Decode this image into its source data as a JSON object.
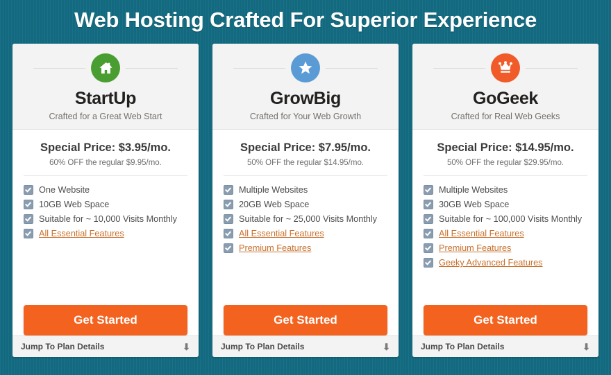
{
  "header": {
    "title": "Web Hosting Crafted For Superior Experience"
  },
  "colors": {
    "page_background": "#136c82",
    "cta_orange": "#f4621f",
    "link_orange": "#c8712d",
    "startup_icon": "#4a9e31",
    "growbig_icon": "#5b9bd5",
    "gogeek_icon": "#f15a29",
    "checkbox": "#8a9cb0"
  },
  "footer_label": "Jump To Plan Details",
  "cta_label": "Get Started",
  "plans": [
    {
      "name": "StartUp",
      "tagline": "Crafted for a Great Web Start",
      "icon": "house-icon",
      "icon_color": "#4a9e31",
      "price": "Special Price: $3.95/mo.",
      "discount": "60% OFF the regular $9.95/mo.",
      "cta": "Get Started",
      "footer": "Jump To Plan Details",
      "features": [
        {
          "text": "One Website",
          "link": false
        },
        {
          "text": "10GB Web Space",
          "link": false
        },
        {
          "text": "Suitable for ~ 10,000 Visits Monthly",
          "link": false
        },
        {
          "text": "All Essential Features",
          "link": true
        }
      ]
    },
    {
      "name": "GrowBig",
      "tagline": "Crafted for Your Web Growth",
      "icon": "star-icon",
      "icon_color": "#5b9bd5",
      "price": "Special Price: $7.95/mo.",
      "discount": "50% OFF the regular $14.95/mo.",
      "cta": "Get Started",
      "footer": "Jump To Plan Details",
      "features": [
        {
          "text": "Multiple Websites",
          "link": false
        },
        {
          "text": "20GB Web Space",
          "link": false
        },
        {
          "text": "Suitable for ~ 25,000 Visits Monthly",
          "link": false
        },
        {
          "text": "All Essential Features",
          "link": true
        },
        {
          "text": "Premium Features",
          "link": true
        }
      ]
    },
    {
      "name": "GoGeek",
      "tagline": "Crafted for Real Web Geeks",
      "icon": "crown-icon",
      "icon_color": "#f15a29",
      "price": "Special Price: $14.95/mo.",
      "discount": "50% OFF the regular $29.95/mo.",
      "cta": "Get Started",
      "footer": "Jump To Plan Details",
      "features": [
        {
          "text": "Multiple Websites",
          "link": false
        },
        {
          "text": "30GB Web Space",
          "link": false
        },
        {
          "text": "Suitable for ~ 100,000 Visits Monthly",
          "link": false
        },
        {
          "text": "All Essential Features",
          "link": true
        },
        {
          "text": "Premium Features",
          "link": true
        },
        {
          "text": "Geeky Advanced Features",
          "link": true
        }
      ]
    }
  ]
}
